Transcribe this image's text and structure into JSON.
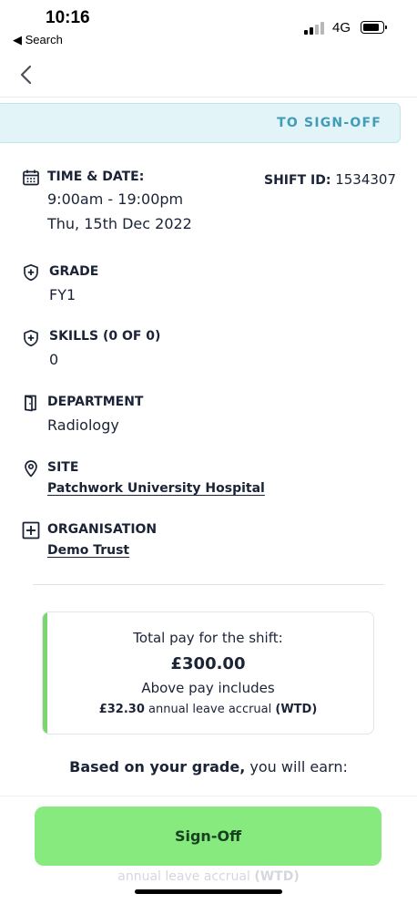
{
  "status_bar": {
    "time": "10:16",
    "back_app": "◀ Search",
    "network": "4G"
  },
  "nav": {
    "back_icon": "chevron-left-icon"
  },
  "status_banner": {
    "text": "TO SIGN-OFF",
    "color": "#3f9db6"
  },
  "shift": {
    "time_date_label": "TIME & DATE:",
    "time_range": "9:00am - 19:00pm",
    "date": "Thu, 15th Dec 2022",
    "shift_id_label": "SHIFT ID:",
    "shift_id": "1534307",
    "grade_label": "GRADE",
    "grade": "FY1",
    "skills_label": "SKILLS (0 OF 0)",
    "skills": "0",
    "department_label": "DEPARTMENT",
    "department": "Radiology",
    "site_label": "SITE",
    "site": "Patchwork University Hospital",
    "organisation_label": "ORGANISATION",
    "organisation": "Demo Trust"
  },
  "pay": {
    "total_label": "Total pay for the shift:",
    "total_amount": "£300.00",
    "includes_label": "Above pay includes",
    "accrual_amount": "£32.30",
    "accrual_text": "annual leave accrual",
    "accrual_suffix": "(WTD)",
    "accent_color": "#7bd66f"
  },
  "grade_earn": {
    "bold": "Based on your grade,",
    "rest": "you will earn:"
  },
  "footer": {
    "ghost_text": "annual leave accrual",
    "ghost_suffix": "(WTD)",
    "signoff_label": "Sign-Off",
    "button_color": "#86ea7f"
  }
}
